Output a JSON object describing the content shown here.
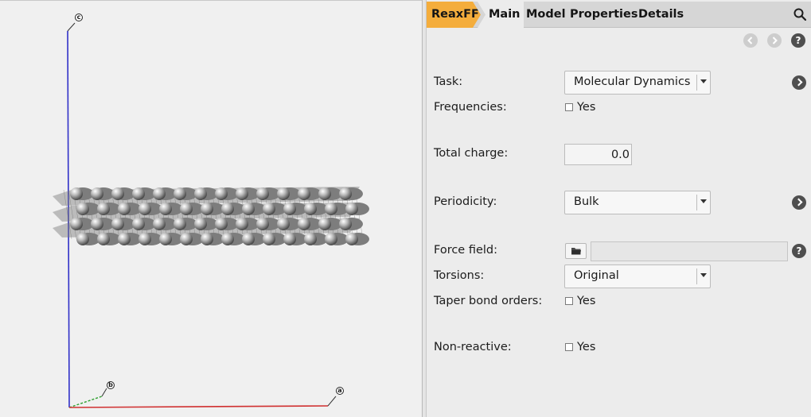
{
  "viewport": {
    "axes": {
      "c": "c",
      "b": "b",
      "a": "a"
    },
    "colors": {
      "c_axis": "#3030c8",
      "b_axis": "#30a030",
      "a_axis": "#d03030",
      "atom": "#9a9a9a"
    }
  },
  "tabs": {
    "items": [
      {
        "label": "ReaxFF"
      },
      {
        "label": "Main"
      },
      {
        "label": "Model"
      },
      {
        "label": "Properties"
      },
      {
        "label": "Details"
      }
    ]
  },
  "nav": {
    "back_icon": "chevron-left-icon",
    "forward_icon": "chevron-right-icon",
    "help": "?"
  },
  "form": {
    "task": {
      "label": "Task:",
      "value": "Molecular Dynamics"
    },
    "frequencies": {
      "label": "Frequencies:",
      "checkbox": "Yes"
    },
    "total_charge": {
      "label": "Total charge:",
      "value": "0.0"
    },
    "periodicity": {
      "label": "Periodicity:",
      "value": "Bulk"
    },
    "force_field": {
      "label": "Force field:",
      "value": "",
      "help": "?"
    },
    "torsions": {
      "label": "Torsions:",
      "value": "Original"
    },
    "taper": {
      "label": "Taper bond orders:",
      "checkbox": "Yes"
    },
    "nonreactive": {
      "label": "Non-reactive:",
      "checkbox": "Yes"
    }
  },
  "colors": {
    "accent": "#f4ad3c",
    "tabbar": "#d6d6d6",
    "panel": "#ececec"
  }
}
